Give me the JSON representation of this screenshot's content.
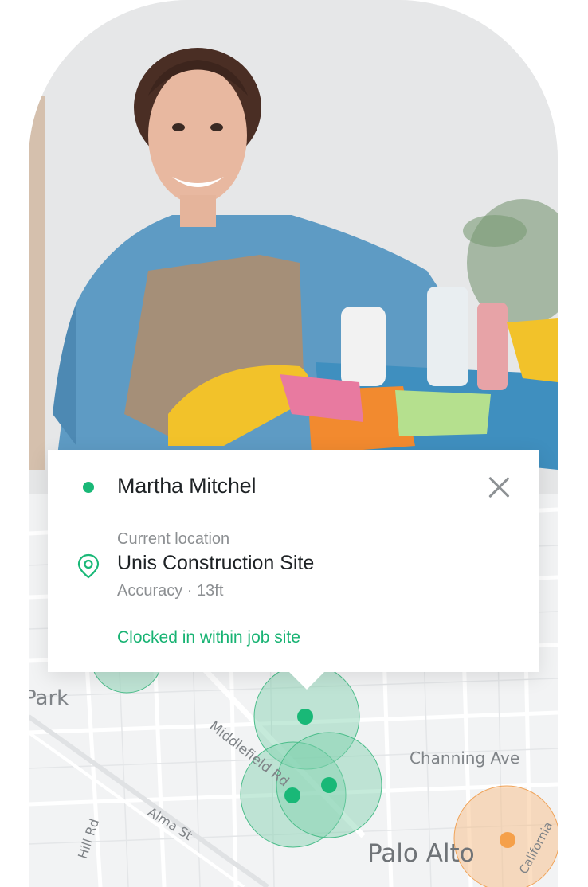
{
  "popup": {
    "employee_name": "Martha Mitchel",
    "location_label": "Current location",
    "site_name": "Unis Construction Site",
    "accuracy": "Accuracy · 13ft",
    "clock_status": "Clocked in within job site"
  },
  "map": {
    "labels": {
      "park": "Park",
      "middlefield": "Middlefield Rd",
      "channing": "Channing Ave",
      "alma": "Alma St",
      "hill": "Hill Rd",
      "palo_alto": "Palo Alto",
      "california": "California"
    }
  },
  "colors": {
    "accent_green": "#19b877",
    "orange_marker": "#f5a04a"
  },
  "icons": {
    "status": "online-dot-icon",
    "location": "location-pin-icon",
    "close": "close-icon"
  }
}
